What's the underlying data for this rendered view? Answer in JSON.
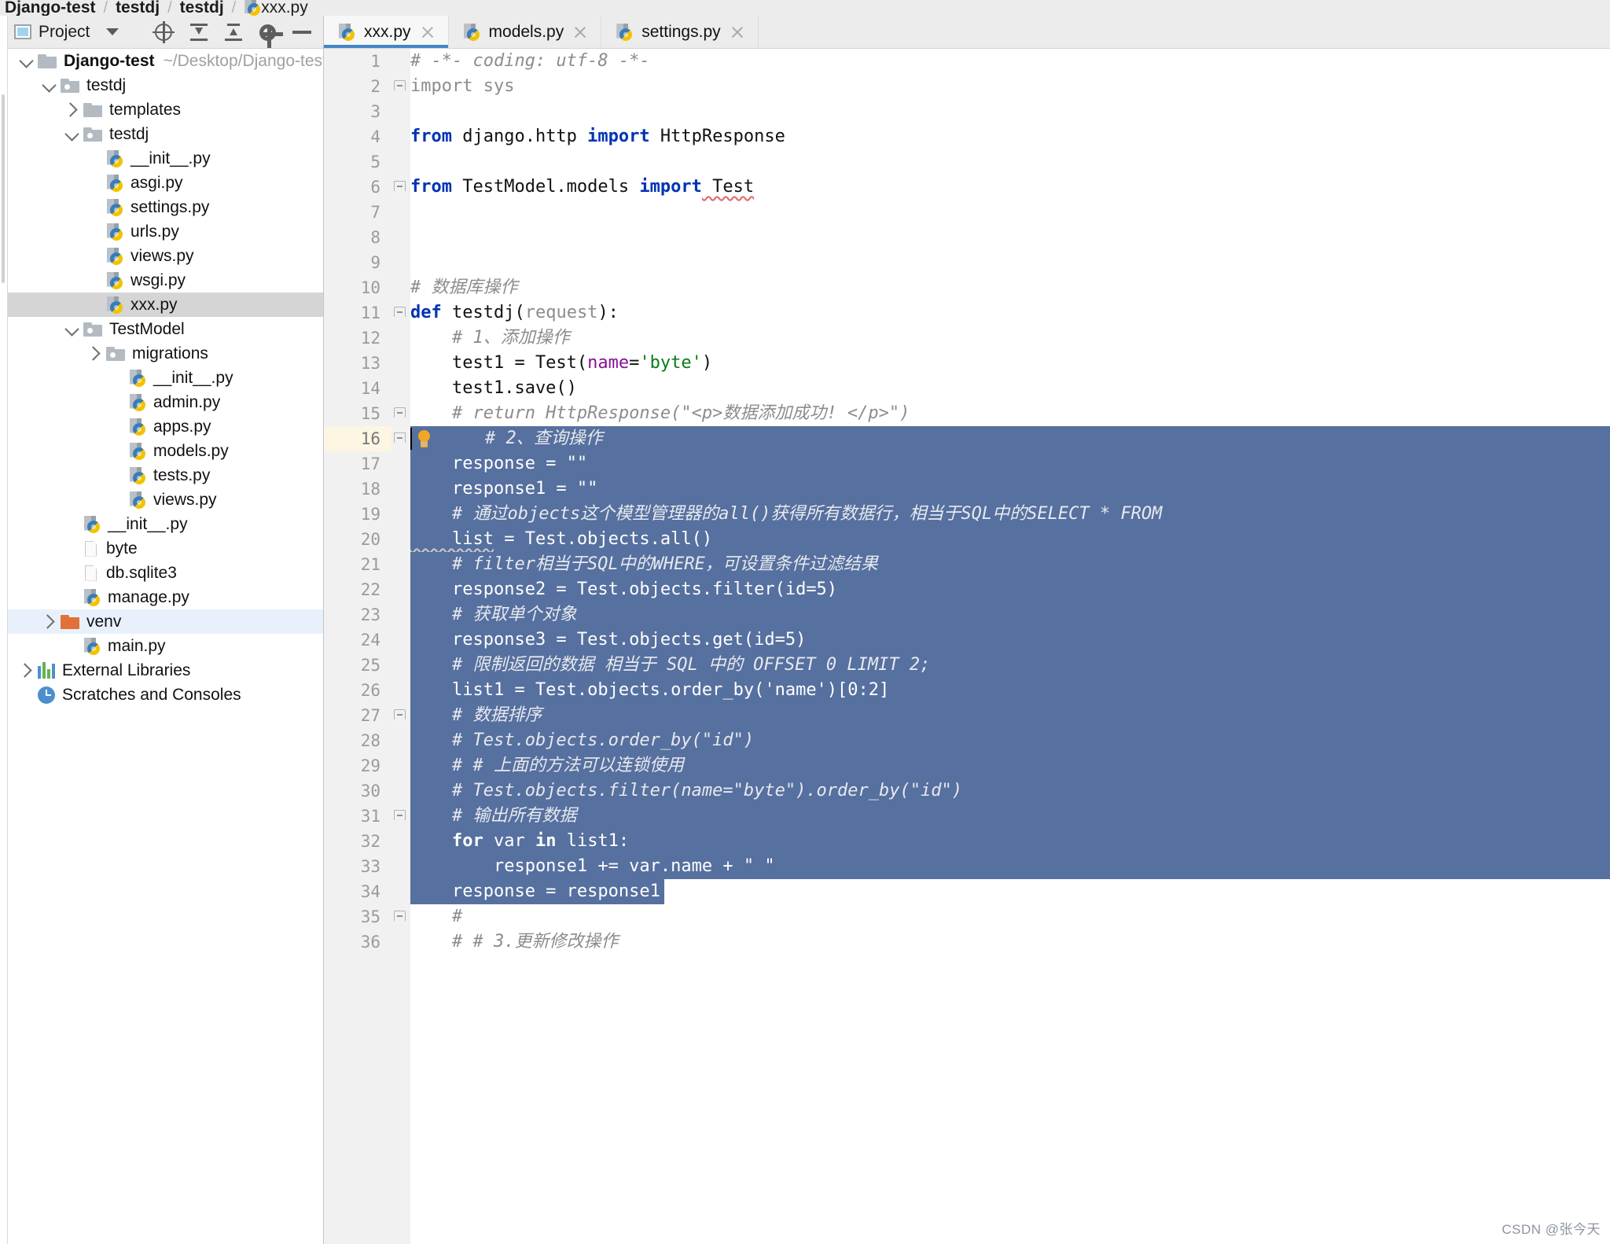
{
  "breadcrumb": {
    "items": [
      "Django-test",
      "testdj",
      "testdj",
      "xxx.py"
    ],
    "separator": "/"
  },
  "project_panel": {
    "title": "Project",
    "icons": {
      "window": "window-icon",
      "dropdown": "chevron-down-icon",
      "locate": "select-opened-file-icon",
      "expand_all": "expand-all-icon",
      "collapse_all": "collapse-all-icon",
      "settings": "gear-icon",
      "hide": "minimize-icon"
    },
    "tree": [
      {
        "label": "Django-test",
        "path": "~/Desktop/Django-test",
        "depth": 0,
        "icon": "folder",
        "arrow": "down",
        "bold": true,
        "selected": false
      },
      {
        "label": "testdj",
        "path": "",
        "depth": 1,
        "icon": "module-folder",
        "arrow": "down",
        "bold": false,
        "selected": false
      },
      {
        "label": "templates",
        "path": "",
        "depth": 2,
        "icon": "folder",
        "arrow": "right",
        "bold": false,
        "selected": false
      },
      {
        "label": "testdj",
        "path": "",
        "depth": 2,
        "icon": "module-folder",
        "arrow": "down",
        "bold": false,
        "selected": false
      },
      {
        "label": "__init__.py",
        "path": "",
        "depth": 3,
        "icon": "python",
        "arrow": "",
        "bold": false,
        "selected": false
      },
      {
        "label": "asgi.py",
        "path": "",
        "depth": 3,
        "icon": "python",
        "arrow": "",
        "bold": false,
        "selected": false
      },
      {
        "label": "settings.py",
        "path": "",
        "depth": 3,
        "icon": "python",
        "arrow": "",
        "bold": false,
        "selected": false
      },
      {
        "label": "urls.py",
        "path": "",
        "depth": 3,
        "icon": "python",
        "arrow": "",
        "bold": false,
        "selected": false
      },
      {
        "label": "views.py",
        "path": "",
        "depth": 3,
        "icon": "python",
        "arrow": "",
        "bold": false,
        "selected": false
      },
      {
        "label": "wsgi.py",
        "path": "",
        "depth": 3,
        "icon": "python",
        "arrow": "",
        "bold": false,
        "selected": false
      },
      {
        "label": "xxx.py",
        "path": "",
        "depth": 3,
        "icon": "python",
        "arrow": "",
        "bold": false,
        "selected": true
      },
      {
        "label": "TestModel",
        "path": "",
        "depth": 2,
        "icon": "module-folder",
        "arrow": "down",
        "bold": false,
        "selected": false
      },
      {
        "label": "migrations",
        "path": "",
        "depth": 3,
        "icon": "module-folder",
        "arrow": "right",
        "bold": false,
        "selected": false
      },
      {
        "label": "__init__.py",
        "path": "",
        "depth": 4,
        "icon": "python",
        "arrow": "",
        "bold": false,
        "selected": false
      },
      {
        "label": "admin.py",
        "path": "",
        "depth": 4,
        "icon": "python",
        "arrow": "",
        "bold": false,
        "selected": false
      },
      {
        "label": "apps.py",
        "path": "",
        "depth": 4,
        "icon": "python",
        "arrow": "",
        "bold": false,
        "selected": false
      },
      {
        "label": "models.py",
        "path": "",
        "depth": 4,
        "icon": "python",
        "arrow": "",
        "bold": false,
        "selected": false
      },
      {
        "label": "tests.py",
        "path": "",
        "depth": 4,
        "icon": "python",
        "arrow": "",
        "bold": false,
        "selected": false
      },
      {
        "label": "views.py",
        "path": "",
        "depth": 4,
        "icon": "python",
        "arrow": "",
        "bold": false,
        "selected": false
      },
      {
        "label": "__init__.py",
        "path": "",
        "depth": 2,
        "icon": "python",
        "arrow": "",
        "bold": false,
        "selected": false
      },
      {
        "label": "byte",
        "path": "",
        "depth": 2,
        "icon": "file",
        "arrow": "",
        "bold": false,
        "selected": false
      },
      {
        "label": "db.sqlite3",
        "path": "",
        "depth": 2,
        "icon": "file",
        "arrow": "",
        "bold": false,
        "selected": false
      },
      {
        "label": "manage.py",
        "path": "",
        "depth": 2,
        "icon": "python",
        "arrow": "",
        "bold": false,
        "selected": false
      },
      {
        "label": "venv",
        "path": "",
        "depth": 1,
        "icon": "venv-folder",
        "arrow": "right",
        "bold": false,
        "selected": false,
        "highlight": true
      },
      {
        "label": "main.py",
        "path": "",
        "depth": 2,
        "icon": "python",
        "arrow": "",
        "bold": false,
        "selected": false
      },
      {
        "label": "External Libraries",
        "path": "",
        "depth": 0,
        "icon": "libraries",
        "arrow": "right",
        "bold": false,
        "selected": false
      },
      {
        "label": "Scratches and Consoles",
        "path": "",
        "depth": 0,
        "icon": "scratches",
        "arrow": "",
        "bold": false,
        "selected": false
      }
    ]
  },
  "editor": {
    "tabs": [
      {
        "label": "xxx.py",
        "active": true
      },
      {
        "label": "models.py",
        "active": false
      },
      {
        "label": "settings.py",
        "active": false
      }
    ],
    "selection_range": [
      16,
      34
    ],
    "current_line": 16,
    "lines": [
      {
        "n": 1,
        "fold": "",
        "tokens": [
          {
            "t": "# -*- coding: utf-8 -*-",
            "c": "cmt",
            "indent": 0
          }
        ]
      },
      {
        "n": 2,
        "fold": "start-import",
        "tokens": [
          {
            "t": "import sys",
            "c": "dim",
            "indent": 0
          }
        ]
      },
      {
        "n": 3,
        "fold": "",
        "tokens": []
      },
      {
        "n": 4,
        "fold": "",
        "tokens": [
          {
            "t": "from",
            "c": "kw"
          },
          {
            "t": " django.http ",
            "c": "ident"
          },
          {
            "t": "import",
            "c": "kw"
          },
          {
            "t": " HttpResponse",
            "c": "ident"
          }
        ]
      },
      {
        "n": 5,
        "fold": "",
        "tokens": []
      },
      {
        "n": 6,
        "fold": "end-import",
        "tokens": [
          {
            "t": "from",
            "c": "kw"
          },
          {
            "t": " TestModel.models ",
            "c": "ident"
          },
          {
            "t": "import",
            "c": "kw"
          },
          {
            "t": " Test",
            "c": "squiggle-red"
          }
        ]
      },
      {
        "n": 7,
        "fold": "",
        "tokens": []
      },
      {
        "n": 8,
        "fold": "",
        "tokens": []
      },
      {
        "n": 9,
        "fold": "",
        "tokens": []
      },
      {
        "n": 10,
        "fold": "",
        "tokens": [
          {
            "t": "# 数据库操作",
            "c": "cmt"
          }
        ]
      },
      {
        "n": 11,
        "fold": "start",
        "tokens": [
          {
            "t": "def",
            "c": "kw"
          },
          {
            "t": " testdj(",
            "c": "ident"
          },
          {
            "t": "request",
            "c": "dim"
          },
          {
            "t": "):",
            "c": "ident"
          }
        ]
      },
      {
        "n": 12,
        "fold": "",
        "tokens": [
          {
            "t": "    # 1、添加操作",
            "c": "cmt"
          }
        ]
      },
      {
        "n": 13,
        "fold": "",
        "tokens": [
          {
            "t": "    test1 = Test(",
            "c": "ident"
          },
          {
            "t": "name",
            "c": "param"
          },
          {
            "t": "=",
            "c": "ident"
          },
          {
            "t": "'byte'",
            "c": "str"
          },
          {
            "t": ")",
            "c": "ident"
          }
        ]
      },
      {
        "n": 14,
        "fold": "",
        "tokens": [
          {
            "t": "    test1.save()",
            "c": "ident"
          }
        ]
      },
      {
        "n": 15,
        "fold": "start",
        "tokens": [
          {
            "t": "    # return HttpResponse(\"<p>数据添加成功! </p>\")",
            "c": "cmt"
          }
        ]
      },
      {
        "n": 16,
        "fold": "end",
        "bulb": true,
        "caret": true,
        "tokens": [
          {
            "t": "    # 2、查询操作",
            "c": "cmt"
          }
        ]
      },
      {
        "n": 17,
        "fold": "",
        "tokens": [
          {
            "t": "    response = \"\"",
            "c": "ident"
          }
        ]
      },
      {
        "n": 18,
        "fold": "",
        "tokens": [
          {
            "t": "    response1 = \"\"",
            "c": "ident"
          }
        ]
      },
      {
        "n": 19,
        "fold": "",
        "tokens": [
          {
            "t": "    # 通过objects这个模型管理器的all()获得所有数据行，相当于SQL中的SELECT * FROM",
            "c": "cmt"
          }
        ]
      },
      {
        "n": 20,
        "fold": "",
        "tokens": [
          {
            "t": "    list",
            "c": "squiggle"
          },
          {
            "t": " = Test.objects.all()",
            "c": "ident"
          }
        ]
      },
      {
        "n": 21,
        "fold": "",
        "tokens": [
          {
            "t": "    # filter相当于SQL中的WHERE，可设置条件过滤结果",
            "c": "cmt"
          }
        ]
      },
      {
        "n": 22,
        "fold": "",
        "tokens": [
          {
            "t": "    response2 = Test.objects.filter(id=5)",
            "c": "ident"
          }
        ]
      },
      {
        "n": 23,
        "fold": "",
        "tokens": [
          {
            "t": "    # 获取单个对象",
            "c": "cmt"
          }
        ]
      },
      {
        "n": 24,
        "fold": "",
        "tokens": [
          {
            "t": "    response3 = Test.objects.get(id=5)",
            "c": "ident"
          }
        ]
      },
      {
        "n": 25,
        "fold": "",
        "tokens": [
          {
            "t": "    # 限制返回的数据 相当于 SQL 中的 OFFSET 0 LIMIT 2;",
            "c": "cmt"
          }
        ]
      },
      {
        "n": 26,
        "fold": "",
        "tokens": [
          {
            "t": "    list1 = Test.objects.order_by('name')[0:2]",
            "c": "ident"
          }
        ]
      },
      {
        "n": 27,
        "fold": "start",
        "tokens": [
          {
            "t": "    # 数据排序",
            "c": "cmt"
          }
        ]
      },
      {
        "n": 28,
        "fold": "",
        "tokens": [
          {
            "t": "    # Test.objects.order_by(\"id\")",
            "c": "cmt"
          }
        ]
      },
      {
        "n": 29,
        "fold": "",
        "tokens": [
          {
            "t": "    # # 上面的方法可以连锁使用",
            "c": "cmt"
          }
        ]
      },
      {
        "n": 30,
        "fold": "",
        "tokens": [
          {
            "t": "    # Test.objects.filter(name=\"byte\").order_by(\"id\")",
            "c": "cmt"
          }
        ]
      },
      {
        "n": 31,
        "fold": "end",
        "tokens": [
          {
            "t": "    # 输出所有数据",
            "c": "cmt"
          }
        ]
      },
      {
        "n": 32,
        "fold": "",
        "tokens": [
          {
            "t": "    for",
            "c": "kw"
          },
          {
            "t": " var ",
            "c": "ident"
          },
          {
            "t": "in",
            "c": "kw"
          },
          {
            "t": " list1:",
            "c": "ident"
          }
        ]
      },
      {
        "n": 33,
        "fold": "",
        "tokens": [
          {
            "t": "        response1 += var.name + \" \"",
            "c": "ident"
          }
        ]
      },
      {
        "n": 34,
        "fold": "",
        "tokens": [
          {
            "t": "    response = response1",
            "c": "ident"
          }
        ]
      },
      {
        "n": 35,
        "fold": "start",
        "tokens": [
          {
            "t": "    #",
            "c": "cmt"
          }
        ]
      },
      {
        "n": 36,
        "fold": "",
        "tokens": [
          {
            "t": "    # # 3.更新修改操作",
            "c": "cmt"
          }
        ]
      }
    ]
  },
  "watermark": {
    "text": "CSDN @张今天"
  },
  "colors": {
    "selection": "#56709f",
    "accent": "#4286c9",
    "gutter": "#f1f1f1",
    "panel": "#ececec",
    "tree_selected": "#d5d5d5",
    "current_line": "#fdf6e3"
  }
}
